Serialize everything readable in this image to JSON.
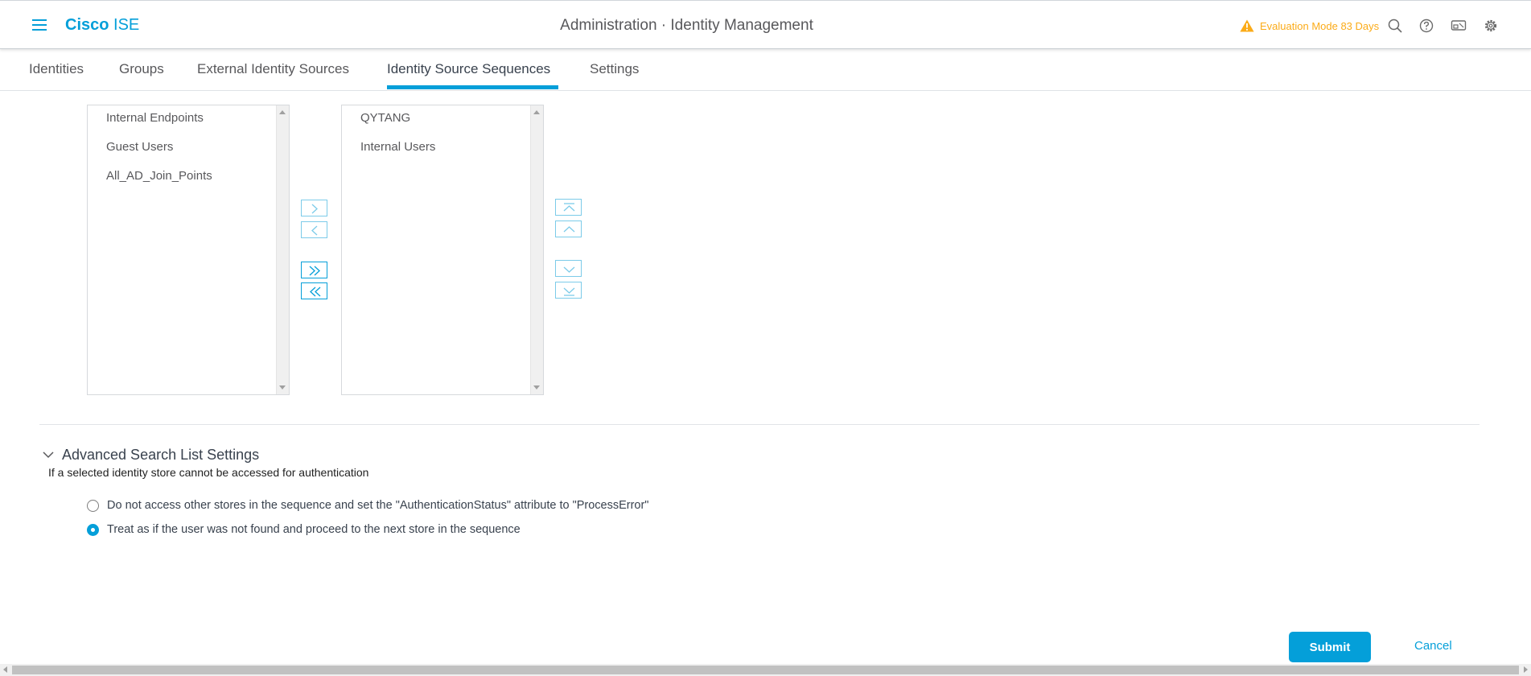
{
  "header": {
    "brand_bold": "Cisco",
    "brand_light": "ISE",
    "title": "Administration · Identity Management",
    "evaluation": "Evaluation Mode 83 Days",
    "icons": [
      "menu-icon",
      "warning-icon",
      "search-icon",
      "help-icon",
      "dashboard-icon",
      "gear-icon"
    ]
  },
  "tabs": [
    {
      "label": "Identities"
    },
    {
      "label": "Groups"
    },
    {
      "label": "External Identity Sources"
    },
    {
      "label": "Identity Source Sequences",
      "active": true
    },
    {
      "label": "Settings"
    }
  ],
  "available_list": {
    "items": [
      "Internal Endpoints",
      "Guest Users",
      "All_AD_Join_Points"
    ]
  },
  "selected_list": {
    "items": [
      "QYTANG",
      "Internal Users"
    ]
  },
  "advanced": {
    "title": "Advanced Search List Settings",
    "description": "If a selected identity store cannot be accessed for authentication",
    "options": [
      {
        "label": "Do not access other stores in the sequence and set the \"AuthenticationStatus\" attribute to \"ProcessError\"",
        "checked": false
      },
      {
        "label": "Treat as if the user was not found and proceed to the next store in the sequence",
        "checked": true
      }
    ]
  },
  "footer": {
    "submit_label": "Submit",
    "cancel_label": "Cancel"
  },
  "colors": {
    "accent": "#049fd9",
    "warning": "#fbab18",
    "text": "#39424e"
  }
}
